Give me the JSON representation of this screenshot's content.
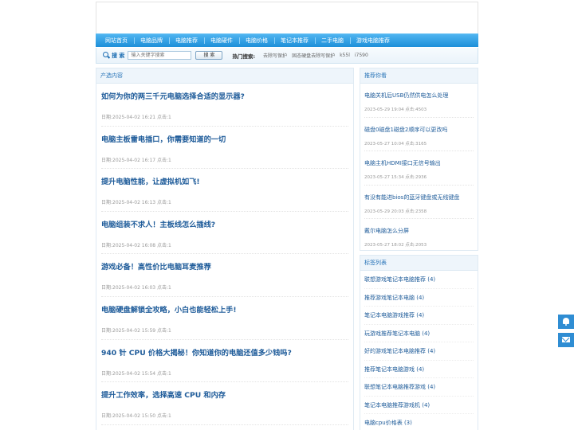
{
  "nav": {
    "items": [
      "网站首页",
      "电脑品牌",
      "电脑推荐",
      "电脑硬件",
      "电脑价格",
      "笔记本推荐",
      "二手电脑",
      "游戏电脑推荐"
    ]
  },
  "search": {
    "label": "搜 索",
    "placeholder": "输入关键字搜索",
    "button": "搜 索",
    "hot_label": "热门搜索:",
    "hot_items": [
      "去除写保护",
      "固态硬盘去除写保护",
      "k55l",
      "i7590"
    ]
  },
  "main": {
    "heading": "产选内容",
    "articles": [
      {
        "title": "如何为你的两三千元电脑选择合适的显示器?",
        "meta": "日期:2025-04-02 16:21  点击:1"
      },
      {
        "title": "电脑主板雷电插口，你需要知道的一切",
        "meta": "日期:2025-04-02 16:17  点击:1"
      },
      {
        "title": "提升电脑性能，让虚拟机如飞!",
        "meta": "日期:2025-04-02 16:13  点击:1"
      },
      {
        "title": "电脑组装不求人！主板线怎么插线?",
        "meta": "日期:2025-04-02 16:08  点击:1"
      },
      {
        "title": "游戏必备！高性价比电脑耳麦推荐",
        "meta": "日期:2025-04-02 16:03  点击:1"
      },
      {
        "title": "电脑硬盘解锁全攻略，小白也能轻松上手!",
        "meta": "日期:2025-04-02 15:59  点击:1"
      },
      {
        "title": "940 针 CPU 价格大揭秘！你知道你的电脑还值多少钱吗?",
        "meta": "日期:2025-04-02 15:54  点击:1"
      },
      {
        "title": "提升工作效率，选择高速 CPU 和内存",
        "meta": "日期:2025-04-02 15:50  点击:1"
      }
    ]
  },
  "recommend": {
    "heading": "推荐你看",
    "items": [
      {
        "title": "电脑关机后USB仍然供电怎么处理",
        "meta": "2023-05-29 19:04  点击:4503"
      },
      {
        "title": "磁盘0磁盘1磁盘2顺序可以更改吗",
        "meta": "2023-05-27 10:04  点击:3165"
      },
      {
        "title": "电脑主机HDMI接口无信号输出",
        "meta": "2023-05-27 15:34  点击:2936"
      },
      {
        "title": "有没有能进bios的蓝牙键盘或无线键盘",
        "meta": "2023-05-29 20:03  点击:2358"
      },
      {
        "title": "戴尔电脑怎么分屏",
        "meta": "2023-05-27 18:02  点击:2053"
      }
    ]
  },
  "tags": {
    "heading": "标签列表",
    "items": [
      "联想游戏笔记本电脑推荐 (4)",
      "推荐游戏笔记本电脑 (4)",
      "笔记本电脑游戏推荐 (4)",
      "玩游戏推荐笔记本电脑 (4)",
      "好的游戏笔记本电脑推荐 (4)",
      "推荐笔记本电脑游戏 (4)",
      "联想笔记本电脑推荐游戏 (4)",
      "笔记本电脑推荐游戏机 (4)",
      "电脑cpu价格表 (3)"
    ]
  },
  "float": {
    "icons": [
      "bell-icon",
      "mail-icon"
    ],
    "color": "#2f8dd3"
  }
}
